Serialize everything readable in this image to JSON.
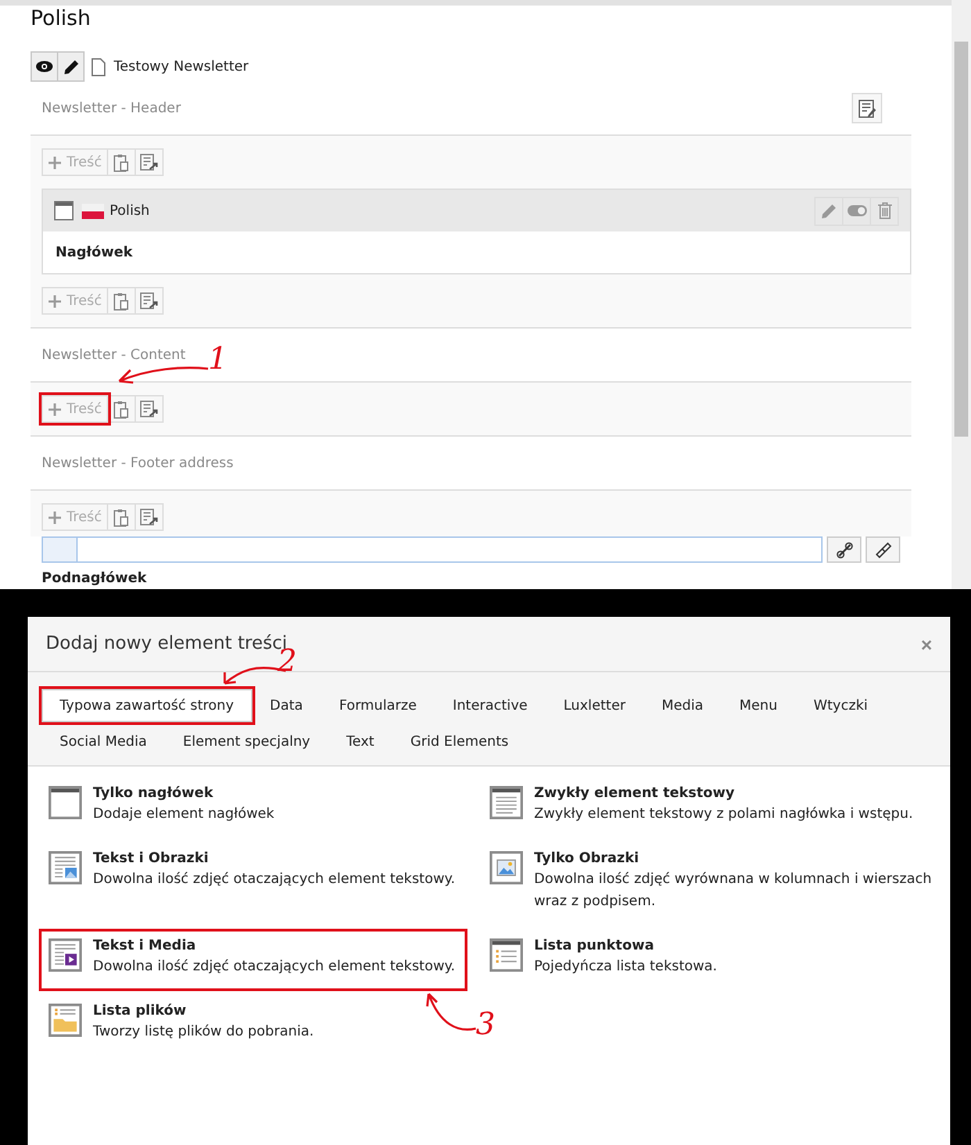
{
  "page": {
    "title": "Polish",
    "record": "Testowy Newsletter"
  },
  "sections": [
    {
      "title": "Newsletter - Header",
      "edit_button": true,
      "add_label": "Treść",
      "elements": [
        {
          "language": "Polish",
          "header": "Nagłówek",
          "add_label": "Treść"
        }
      ]
    },
    {
      "title": "Newsletter - Content",
      "edit_button": false,
      "add_label": "Treść",
      "annotation": "1"
    },
    {
      "title": "Newsletter - Footer address",
      "edit_button": false,
      "add_label": "Treść"
    }
  ],
  "form_peek": {
    "label": "Podnagłówek"
  },
  "dialog": {
    "title": "Dodaj nowy element treści",
    "close": "×",
    "tabs": [
      {
        "label": "Typowa zawartość strony",
        "selected": true,
        "annotation": "2"
      },
      {
        "label": "Data",
        "selected": false
      },
      {
        "label": "Formularze",
        "selected": false
      },
      {
        "label": "Interactive",
        "selected": false
      },
      {
        "label": "Luxletter",
        "selected": false
      },
      {
        "label": "Media",
        "selected": false
      },
      {
        "label": "Menu",
        "selected": false
      },
      {
        "label": "Wtyczki",
        "selected": false
      },
      {
        "label": "Social Media",
        "selected": false
      },
      {
        "label": "Element specjalny",
        "selected": false
      },
      {
        "label": "Text",
        "selected": false
      },
      {
        "label": "Grid Elements",
        "selected": false
      }
    ],
    "items": [
      {
        "title": "Tylko nagłówek",
        "description": "Dodaje element nagłówek",
        "kind": "header"
      },
      {
        "title": "Zwykły element tekstowy",
        "description": "Zwykły element tekstowy z polami nagłówka i wstępu.",
        "kind": "text"
      },
      {
        "title": "Tekst i Obrazki",
        "description": "Dowolna ilość zdjęć otaczających element tekstowy.",
        "kind": "textpic"
      },
      {
        "title": "Tylko Obrazki",
        "description": "Dowolna ilość zdjęć wyrównana w kolumnach i wierszach wraz z podpisem.",
        "kind": "images"
      },
      {
        "title": "Tekst i Media",
        "description": "Dowolna ilość zdjęć otaczających element tekstowy.",
        "kind": "textmedia",
        "annotation": "3"
      },
      {
        "title": "Lista punktowa",
        "description": "Pojedyńcza lista tekstowa.",
        "kind": "bullets"
      },
      {
        "title": "Lista plików",
        "description": "Tworzy listę plików do pobrania.",
        "kind": "files"
      }
    ]
  }
}
